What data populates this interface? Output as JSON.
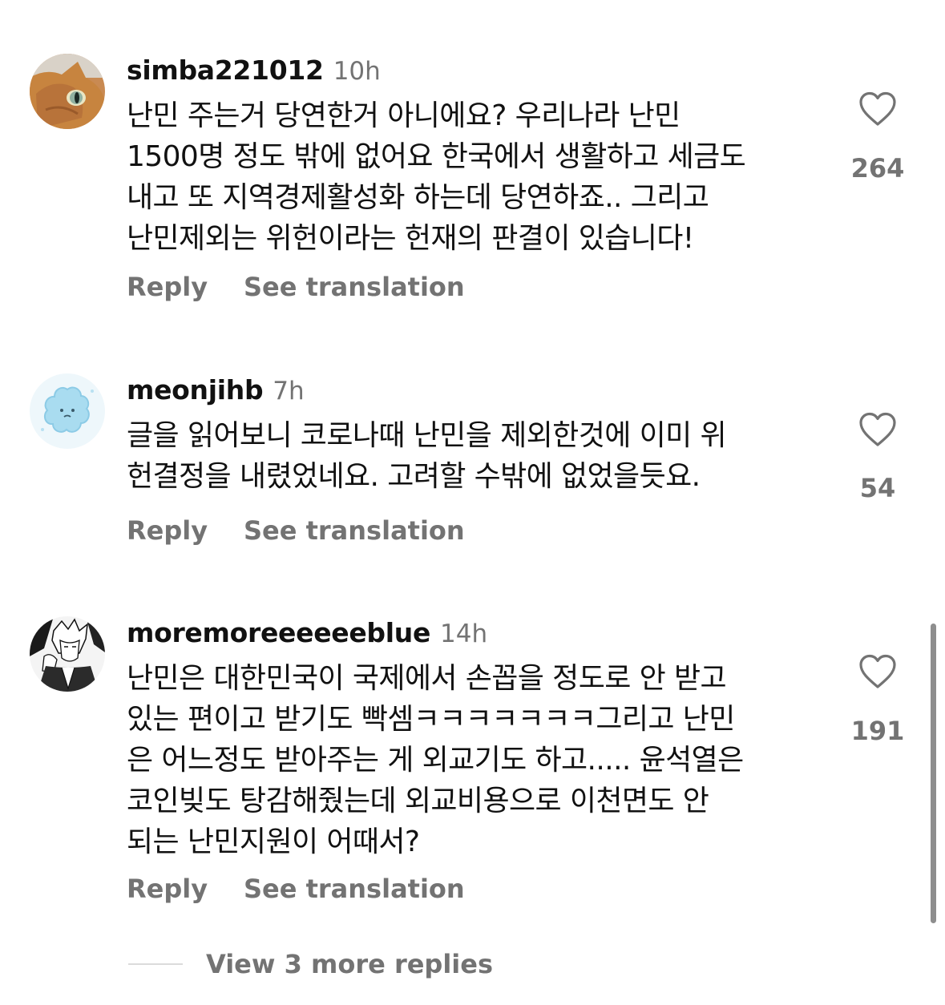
{
  "comments": [
    {
      "username": "simba221012",
      "time": "10h",
      "avatar": "cat-photo-avatar",
      "lines": [
        "난민 주는거 당연한거 아니에요? 우리나라 난민",
        "1500명 정도 밖에 없어요 한국에서 생활하고 세금도",
        "내고 또 지역경제활성화 하는데 당연하죠.. 그리고",
        "난민제외는 위헌이라는 헌재의 판결이 있습니다!"
      ],
      "likes": "264",
      "reply_label": "Reply",
      "translate_label": "See translation"
    },
    {
      "username": "meonjihb",
      "time": "7h",
      "avatar": "blue-dust-character-avatar",
      "lines": [
        "글을 읽어보니 코로나때 난민을 제외한것에 이미 위",
        "헌결정을 내렸었네요. 고려할 수밖에 없었을듯요."
      ],
      "likes": "54",
      "reply_label": "Reply",
      "translate_label": "See translation"
    },
    {
      "username": "moremoreeeeeeblue",
      "time": "14h",
      "avatar": "manga-character-avatar",
      "lines": [
        "난민은 대한민국이 국제에서 손꼽을 정도로 안 받고",
        "있는 편이고 받기도 빡셈ㅋㅋㅋㅋㅋㅋㅋ그리고 난민",
        "은 어느정도 받아주는 게 외교기도 하고..... 윤석열은",
        "코인빚도 탕감해줬는데 외교비용으로 이천면도 안",
        "되는 난민지원이 어때서?"
      ],
      "likes": "191",
      "reply_label": "Reply",
      "translate_label": "See translation"
    }
  ],
  "view_more_replies": "View 3 more replies",
  "icons": {
    "like": "heart-outline-icon"
  },
  "colors": {
    "text_primary": "#111111",
    "text_secondary": "#737373",
    "divider": "#dbdbdb"
  }
}
